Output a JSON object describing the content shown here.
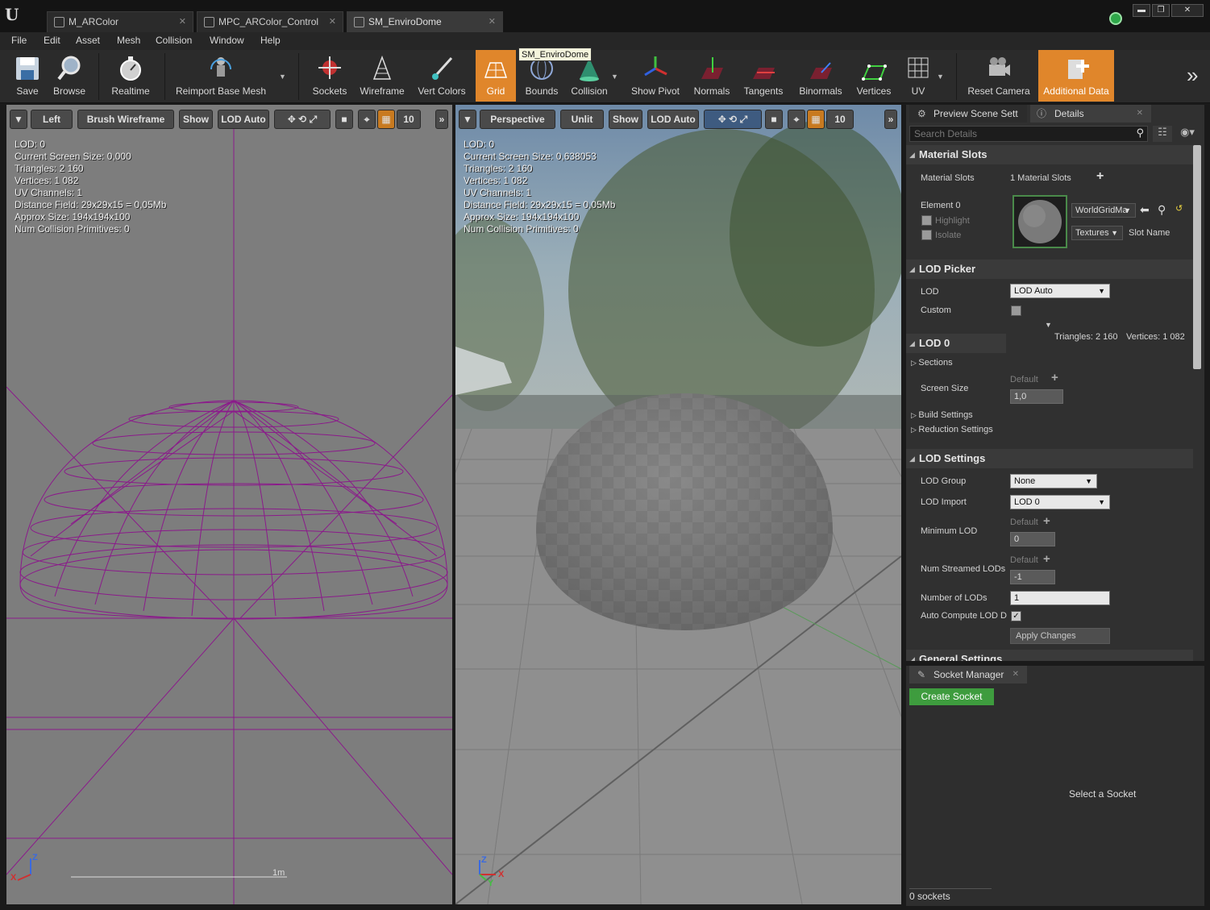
{
  "window": {
    "tabs": [
      {
        "label": "M_ARColor"
      },
      {
        "label": "MPC_ARColor_Control"
      },
      {
        "label": "SM_EnviroDome"
      }
    ],
    "minimize": "▬",
    "maximize": "❐",
    "close": "✕"
  },
  "menu": [
    "File",
    "Edit",
    "Asset",
    "Mesh",
    "Collision",
    "Window",
    "Help"
  ],
  "toolbar": {
    "items": [
      "Save",
      "Browse",
      "Realtime",
      "Reimport Base Mesh",
      "Sockets",
      "Wireframe",
      "Vert Colors",
      "Grid",
      "Bounds",
      "Collision",
      "Show Pivot",
      "Normals",
      "Tangents",
      "Binormals",
      "Vertices",
      "UV",
      "Reset Camera",
      "Additional Data"
    ],
    "active": "Grid",
    "tooltip": "SM_EnviroDome"
  },
  "viewport_left": {
    "view": "Left",
    "mode": "Brush Wireframe",
    "show": "Show",
    "lod": "LOD Auto",
    "grid_snap": "10",
    "scale_label": "1m",
    "axis_z": "Z",
    "axis_x": "X",
    "stats": [
      "LOD:  0",
      "Current Screen Size:  0,000",
      "Triangles:  2 160",
      "Vertices:  1 082",
      "UV Channels:  1",
      "Distance Field:  29x29x15 = 0,05Mb",
      "Approx Size:  194x194x100",
      "Num Collision Primitives:  0"
    ]
  },
  "viewport_right": {
    "view": "Perspective",
    "mode": "Unlit",
    "show": "Show",
    "lod": "LOD Auto",
    "grid_snap": "10",
    "axis_z": "Z",
    "axis_x": "X",
    "axis_y": "Y",
    "stats": [
      "LOD:  0",
      "Current Screen Size:  0,638053",
      "Triangles:  2 160",
      "Vertices:  1 082",
      "UV Channels:  1",
      "Distance Field:  29x29x15 = 0,05Mb",
      "Approx Size:  194x194x100",
      "Num Collision Primitives:  0"
    ]
  },
  "details": {
    "tab_preview": "Preview Scene Sett",
    "tab_details": "Details",
    "search_placeholder": "Search Details",
    "material_slots": {
      "header": "Material Slots",
      "label": "Material Slots",
      "count": "1 Material Slots",
      "element": "Element 0",
      "highlight": "Highlight",
      "isolate": "Isolate",
      "material": "WorldGridMa",
      "textures": "Textures",
      "slot_name": "Slot Name"
    },
    "lod_picker": {
      "header": "LOD Picker",
      "lod_label": "LOD",
      "lod_value": "LOD Auto",
      "custom_label": "Custom"
    },
    "lod0": {
      "header": "LOD 0",
      "triangles": "Triangles: 2 160",
      "vertices": "Vertices: 1 082",
      "sections": "Sections",
      "screen_size": "Screen Size",
      "default": "Default",
      "screen_size_value": "1,0",
      "build_settings": "Build Settings",
      "reduction_settings": "Reduction Settings"
    },
    "lod_settings": {
      "header": "LOD Settings",
      "lod_group": "LOD Group",
      "lod_group_value": "None",
      "lod_import": "LOD Import",
      "lod_import_value": "LOD 0",
      "min_lod": "Minimum LOD",
      "min_default": "Default",
      "min_value": "0",
      "num_streamed": "Num Streamed LODs",
      "streamed_default": "Default",
      "streamed_value": "-1",
      "number_lods": "Number of LODs",
      "number_lods_value": "1",
      "auto_compute": "Auto Compute LOD D",
      "apply": "Apply Changes"
    },
    "general_settings": {
      "header": "General Settings"
    }
  },
  "socket_manager": {
    "tab": "Socket Manager",
    "create": "Create Socket",
    "hint": "Select a Socket",
    "count": "0 sockets"
  },
  "colors": {
    "accent_orange": "#e0862b",
    "wire": "#8b1a8b",
    "create_green": "#3e9c3e"
  }
}
